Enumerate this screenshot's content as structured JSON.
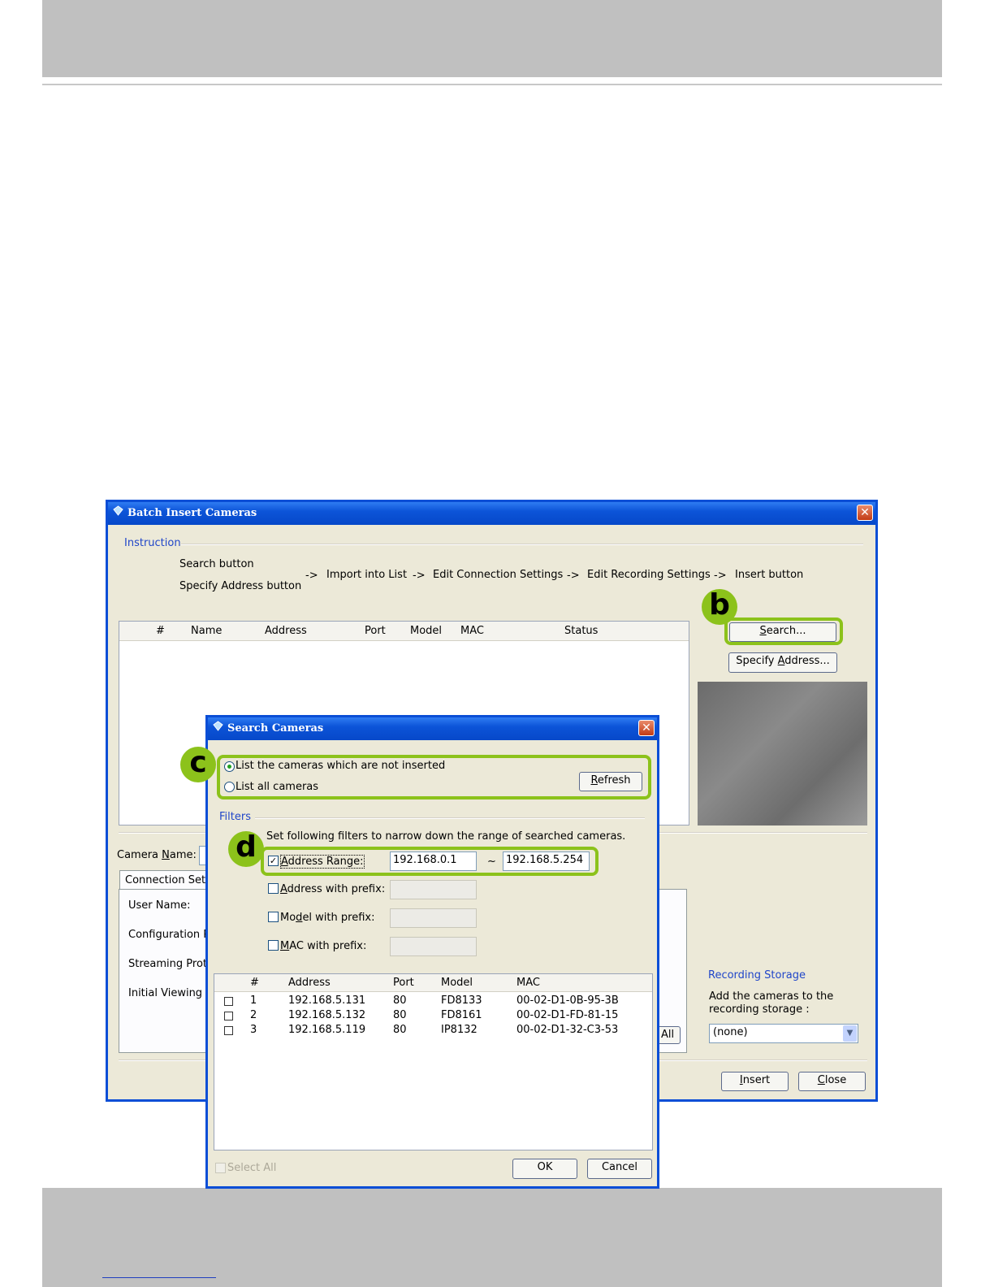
{
  "batch": {
    "title": "Batch Insert Cameras",
    "close": "✕",
    "instruction_label": "Instruction",
    "steps": {
      "search": "Search button",
      "specify": "Specify Address button",
      "arrow": "->",
      "import": "Import into List",
      "edit_conn": "Edit Connection Settings",
      "edit_rec": "Edit Recording Settings",
      "insert": "Insert button"
    },
    "columns": [
      "#",
      "Name",
      "Address",
      "Port",
      "Model",
      "MAC",
      "Status"
    ],
    "search_button": {
      "pre": "",
      "u": "S",
      "post": "earch..."
    },
    "specify_button": {
      "pre": "Specify ",
      "u": "A",
      "post": "ddress..."
    },
    "camera_name": {
      "pre": "Camera ",
      "u": "N",
      "post": "ame:"
    },
    "tab_connection": "Connection Sett",
    "user_name": "User Name:",
    "config_proto": "Configuration Pr",
    "streaming_proto": "Streaming Proto",
    "initial_viewing": "Initial Viewing S",
    "all_button": "All",
    "recording_storage_label": "Recording Storage",
    "recording_storage_desc1": "Add the cameras to the",
    "recording_storage_desc2": "recording storage :",
    "storage_value": "(none)",
    "insert_button": {
      "pre": "",
      "u": "I",
      "post": "nsert"
    },
    "close_button": {
      "pre": "",
      "u": "C",
      "post": "lose"
    }
  },
  "search": {
    "title": "Search Cameras",
    "close": "✕",
    "radio_not_inserted": "List the cameras which are not inserted",
    "radio_all": "List all cameras",
    "refresh_button": {
      "pre": "",
      "u": "R",
      "post": "efresh"
    },
    "filters_label": "Filters",
    "filters_desc": "Set following filters to narrow down the range of searched cameras.",
    "address_range": {
      "pre": "",
      "u": "A",
      "post": "ddress Range:"
    },
    "range_from": "192.168.0.1",
    "range_tilde": "~",
    "range_to": "192.168.5.254",
    "address_prefix": {
      "pre": "",
      "u": "A",
      "post": "ddress with prefix:"
    },
    "model_prefix": {
      "pre": "Mo",
      "u": "d",
      "post": "el with prefix:"
    },
    "mac_prefix": {
      "pre": "",
      "u": "M",
      "post": "AC with prefix:"
    },
    "columns": [
      "#",
      "Address",
      "Port",
      "Model",
      "MAC"
    ],
    "rows": [
      {
        "num": "1",
        "address": "192.168.5.131",
        "port": "80",
        "model": "FD8133",
        "mac": "00-02-D1-0B-95-3B"
      },
      {
        "num": "2",
        "address": "192.168.5.132",
        "port": "80",
        "model": "FD8161",
        "mac": "00-02-D1-FD-81-15"
      },
      {
        "num": "3",
        "address": "192.168.5.119",
        "port": "80",
        "model": "IP8132",
        "mac": "00-02-D1-32-C3-53"
      }
    ],
    "select_all": "Select All",
    "ok_button": "OK",
    "cancel_button": "Cancel"
  },
  "callouts": {
    "b": "b",
    "c": "c",
    "d": "d"
  },
  "colors": {
    "highlight": "#8cc21b",
    "titlebar": "#0648c9",
    "group_label": "#2046c9"
  }
}
